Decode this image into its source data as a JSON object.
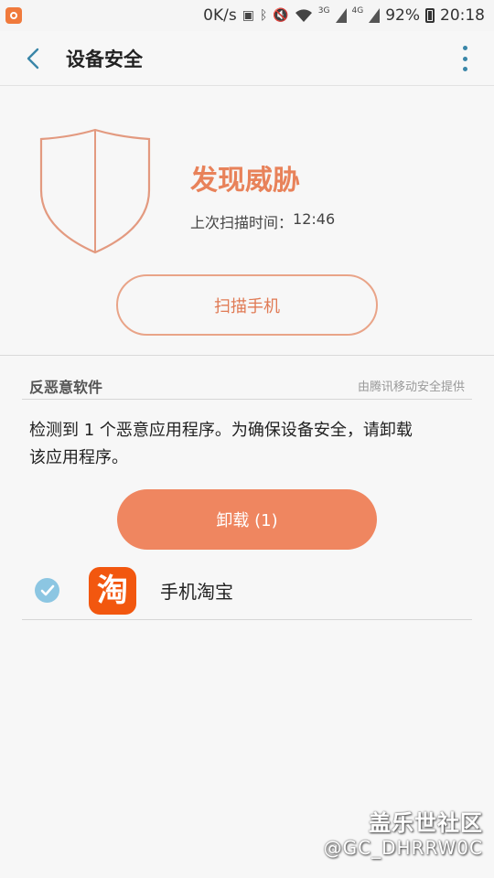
{
  "status_bar": {
    "speed": "0K/s",
    "battery": "92%",
    "time": "20:18",
    "network_3g": "3G",
    "network_4g": "4G"
  },
  "header": {
    "title": "设备安全"
  },
  "threat": {
    "status": "发现威胁",
    "last_scan_label": "上次扫描时间：",
    "last_scan_time": "12:46",
    "scan_button": "扫描手机"
  },
  "section": {
    "title": "反恶意软件",
    "provider": "由腾讯移动安全提供",
    "description": "检测到 1 个恶意应用程序。为确保设备安全，请卸载该应用程序。",
    "uninstall_button": "卸载 (1)"
  },
  "apps": [
    {
      "name": "手机淘宝",
      "icon_char": "淘",
      "checked": true
    }
  ],
  "watermark": {
    "site": "盖乐世社区",
    "user": "@GC_DHRRW0C"
  },
  "colors": {
    "accent": "#ef8660",
    "threat_text": "#e8825a",
    "check": "#8cc6e2",
    "app_icon": "#f2570f"
  }
}
